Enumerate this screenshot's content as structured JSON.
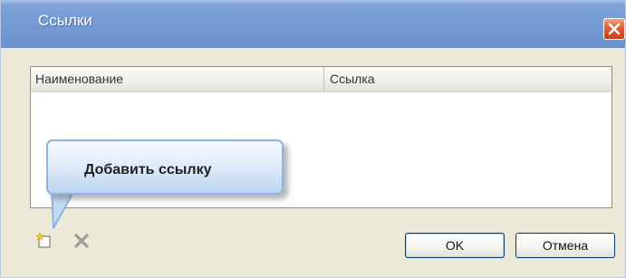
{
  "window": {
    "title": "Ссылки"
  },
  "links_table": {
    "columns": [
      "Наименование",
      "Ссылка"
    ],
    "rows": []
  },
  "callout": {
    "text": "Добавить ссылку"
  },
  "toolbar": {
    "add_icon": "add-link-icon",
    "delete_icon": "delete-link-icon"
  },
  "buttons": {
    "ok_label": "OK",
    "cancel_label": "Отмена"
  },
  "colors": {
    "titlebar": "#7599d2",
    "close_button": "#e15b35",
    "callout": "#dce9f8"
  }
}
